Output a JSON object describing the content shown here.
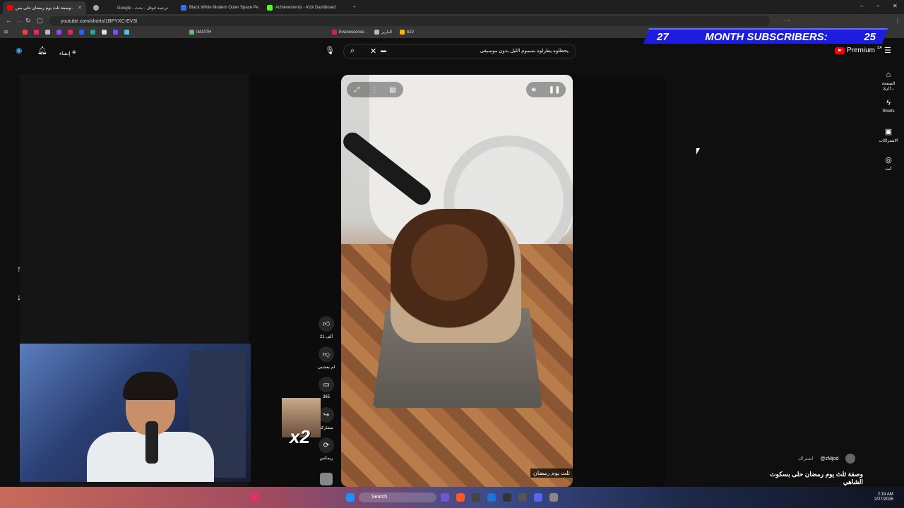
{
  "browser": {
    "tabs": [
      {
        "label": "وصفة ثلث يوم رمضان حلى بس..",
        "active": true
      },
      {
        "label": "",
        "active": false
      },
      {
        "label": "Google - ترجمة قوقل - بحث",
        "active": false
      },
      {
        "label": "Black White Modern Outer Space Pe",
        "active": false
      },
      {
        "label": "Achievements - Kick Dashboard",
        "active": false
      }
    ],
    "new_tab": "+",
    "url": "youtube.com/shorts/1BPYXC-EV3I",
    "bookmarks": [
      "IMJATH",
      "Evanescence -",
      "البارير",
      "b22"
    ]
  },
  "overlay_banner": {
    "left_number": "27",
    "text": "MONTH SUBSCRIBERS:",
    "right_number": "25"
  },
  "youtube": {
    "create_label": "إنشاء",
    "search_query": "يحطلوه يطرلوه بسموم الليل بدون موسيقى",
    "premium_label": "Premium",
    "region": "SA",
    "sidebar": [
      {
        "icon": "home-icon",
        "label": "الصفحة الرئ..."
      },
      {
        "icon": "shorts-icon",
        "label": "Shorts"
      },
      {
        "icon": "subscriptions-icon",
        "label": "الاشتراكات"
      },
      {
        "icon": "you-icon",
        "label": "أنت"
      }
    ],
    "actions": {
      "like_count": "21 ألف",
      "dislike_label": "لم يعجبني",
      "comments_count": "365",
      "share_label": "مشاركة",
      "remix_label": "ريمكس"
    },
    "video_caption": "ثلث يوم رمضان",
    "channel_handle": "@zMjod",
    "subscribe_label": "اشتراك",
    "video_title": "وصفة ثلث يوم رمضان حلى بسكوت الشاهي"
  },
  "stream": {
    "multiplier": "x2"
  },
  "taskbar": {
    "search_label": "Search",
    "time": "2:19 AM",
    "date": "2/27/2026"
  },
  "colors": {
    "banner": "#1d1de0",
    "youtube_red": "#ff0000",
    "background": "#0f0f0f"
  }
}
